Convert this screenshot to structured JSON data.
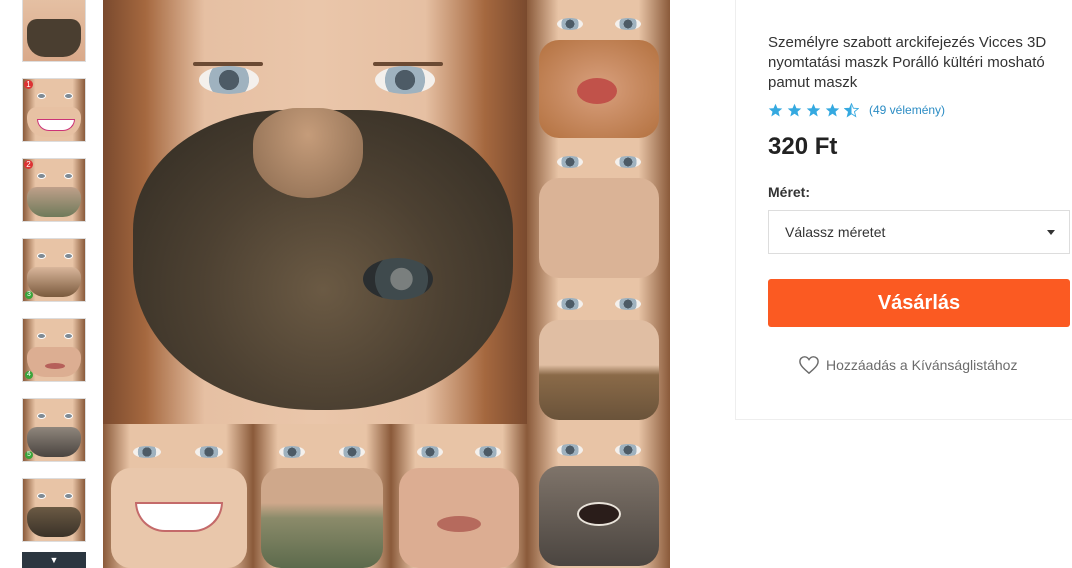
{
  "product": {
    "title": "Személyre szabott arckifejezés Vicces 3D nyomtatási maszk Porálló kültéri mosható pamut maszk",
    "rating": 4.5,
    "reviews_text": "(49 vélemény)",
    "price": "320 Ft",
    "size_label": "Méret:",
    "size_select_value": "Válassz méretet",
    "buy_label": "Vásárlás",
    "wishlist_label": "Hozzáadás a Kívánságlistához"
  },
  "colors": {
    "accent": "#fb5a22",
    "star": "#35a9e0",
    "link": "#2b8cc4"
  },
  "thumbnails": [
    {
      "icon": "beard-mask-thumb"
    },
    {
      "icon": "smile-mask-thumb",
      "badge": "1"
    },
    {
      "icon": "mustache-mask-thumb",
      "badge": "2"
    },
    {
      "icon": "beard-mask-thumb-2",
      "gbadge": "3"
    },
    {
      "icon": "lips-mask-thumb",
      "gbadge": "4"
    },
    {
      "icon": "teeth-mask-thumb",
      "gbadge": "5"
    },
    {
      "icon": "cigar-mask-thumb"
    }
  ],
  "thumb_more_icon": "chevron-down-icon"
}
